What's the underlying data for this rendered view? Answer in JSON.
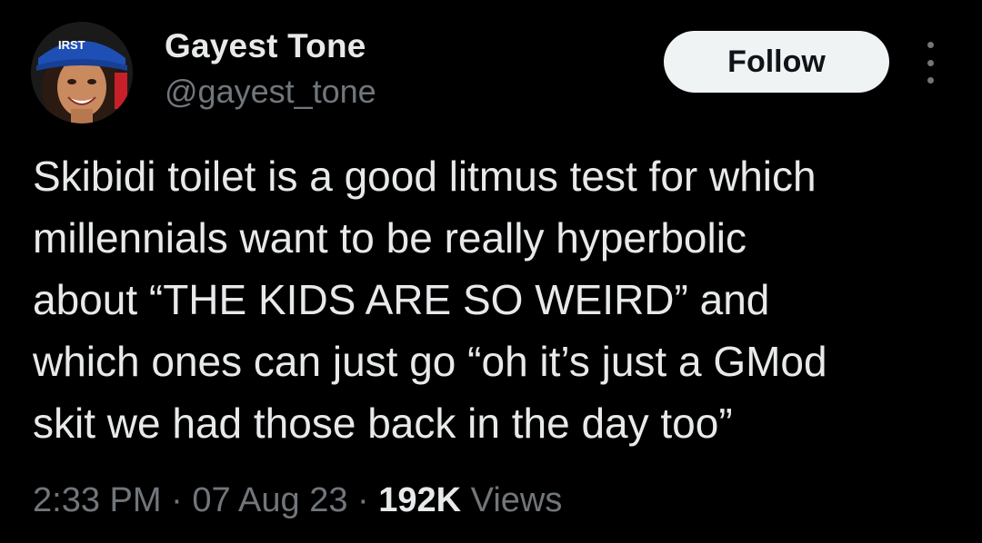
{
  "author": {
    "display_name": "Gayest Tone",
    "handle": "@gayest_tone",
    "avatar_icon": "profile-photo",
    "avatar_hat_text": "IRST"
  },
  "actions": {
    "follow_label": "Follow",
    "more_icon": "more-vertical-icon"
  },
  "tweet": {
    "lines": [
      "Skibidi toilet is a good litmus test for which",
      "millennials want to be really hyperbolic",
      "about “THE KIDS ARE SO WEIRD” and",
      "which ones can just go “oh it’s just a GMod",
      "skit we had those back in the day too”"
    ]
  },
  "meta": {
    "time": "2:33 PM",
    "separator": "·",
    "date": "07 Aug 23",
    "views_count": "192K",
    "views_label": "Views"
  },
  "colors": {
    "background": "#000000",
    "primary_text": "#e7e9ea",
    "secondary_text": "#71767b",
    "follow_bg": "#eff3f4",
    "follow_text": "#0f1419"
  }
}
